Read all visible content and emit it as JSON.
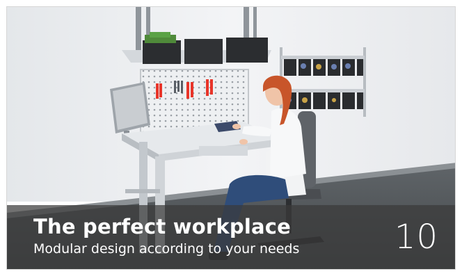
{
  "teaser": {
    "title": "The perfect workplace",
    "subtitle": "Modular design according to your needs",
    "count": "10"
  },
  "colors": {
    "overlay": "#3a3a3a",
    "accent": "#e8352a",
    "text": "#ffffff"
  }
}
